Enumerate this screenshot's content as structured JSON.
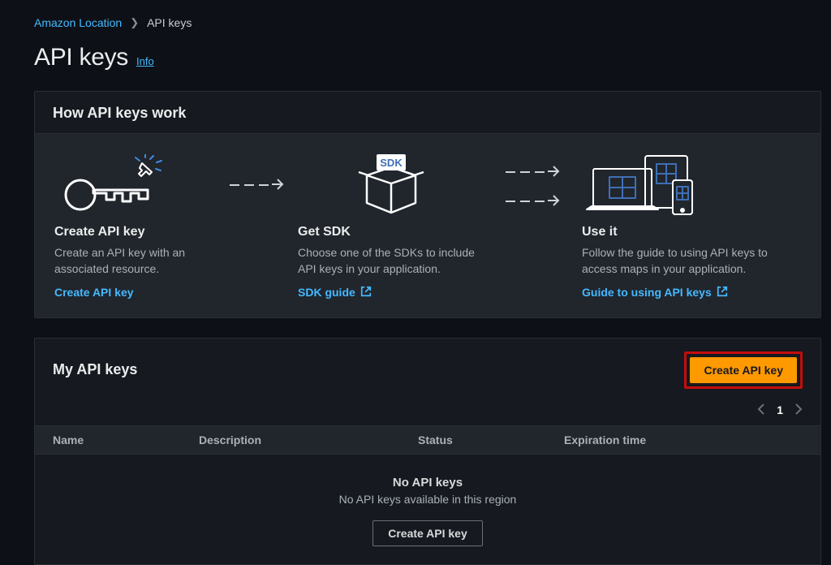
{
  "breadcrumb": {
    "root": "Amazon Location",
    "current": "API keys"
  },
  "header": {
    "title": "API keys",
    "info": "Info"
  },
  "how": {
    "title": "How API keys work",
    "steps": [
      {
        "title": "Create API key",
        "desc": "Create an API key with an associated resource.",
        "link": "Create API key"
      },
      {
        "title": "Get SDK",
        "desc": "Choose one of the SDKs to include API keys in your application.",
        "link": "SDK guide"
      },
      {
        "title": "Use it",
        "desc": "Follow the guide to using API keys to access maps in your application.",
        "link": "Guide to using API keys"
      }
    ],
    "sdk_badge": "SDK"
  },
  "table": {
    "title": "My API keys",
    "create_button": "Create API key",
    "page": "1",
    "columns": {
      "name": "Name",
      "description": "Description",
      "status": "Status",
      "expiration": "Expiration time"
    },
    "empty": {
      "title": "No API keys",
      "desc": "No API keys available in this region",
      "button": "Create API key"
    }
  }
}
